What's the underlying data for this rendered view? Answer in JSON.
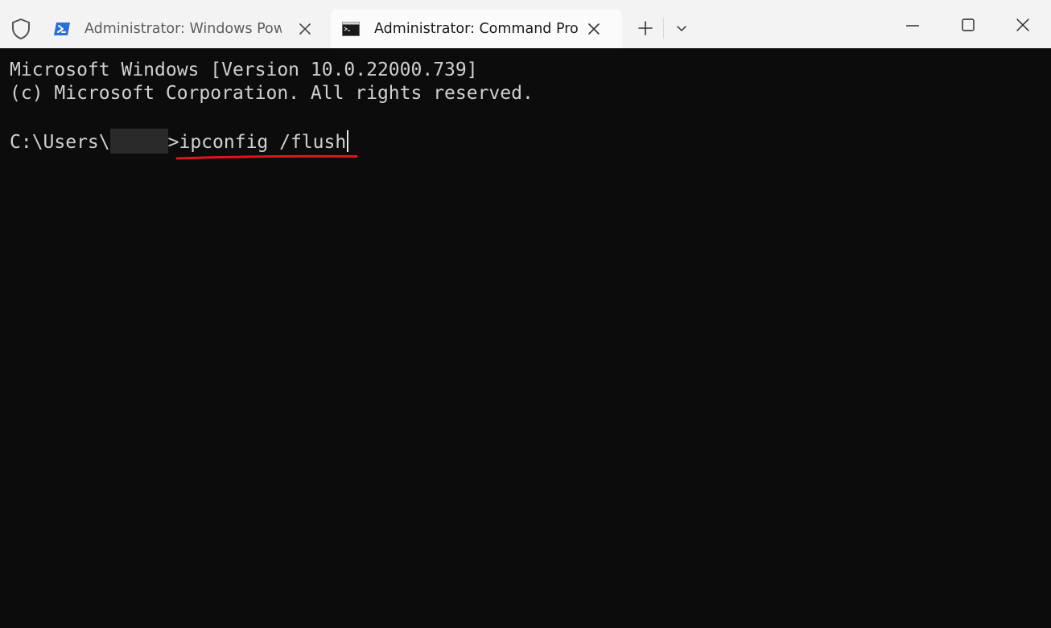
{
  "tabs": [
    {
      "title": "Administrator: Windows Powe",
      "icon": "powershell-icon",
      "active": false
    },
    {
      "title": "Administrator: Command Pro",
      "icon": "command-prompt-icon",
      "active": true
    }
  ],
  "terminal": {
    "lines": [
      "Microsoft Windows [Version 10.0.22000.739]",
      "(c) Microsoft Corporation. All rights reserved."
    ],
    "prompt_prefix": "C:\\Users\\",
    "prompt_suffix": ">",
    "command": "ipconfig /flush"
  },
  "colors": {
    "terminal_bg": "#0c0c0c",
    "terminal_fg": "#d0d0d0",
    "titlebar_bg": "#f3f3f3",
    "active_tab_bg": "#fbfbfb",
    "annotation_underline": "#e0141e",
    "powershell_blue": "#2a6fd6"
  }
}
